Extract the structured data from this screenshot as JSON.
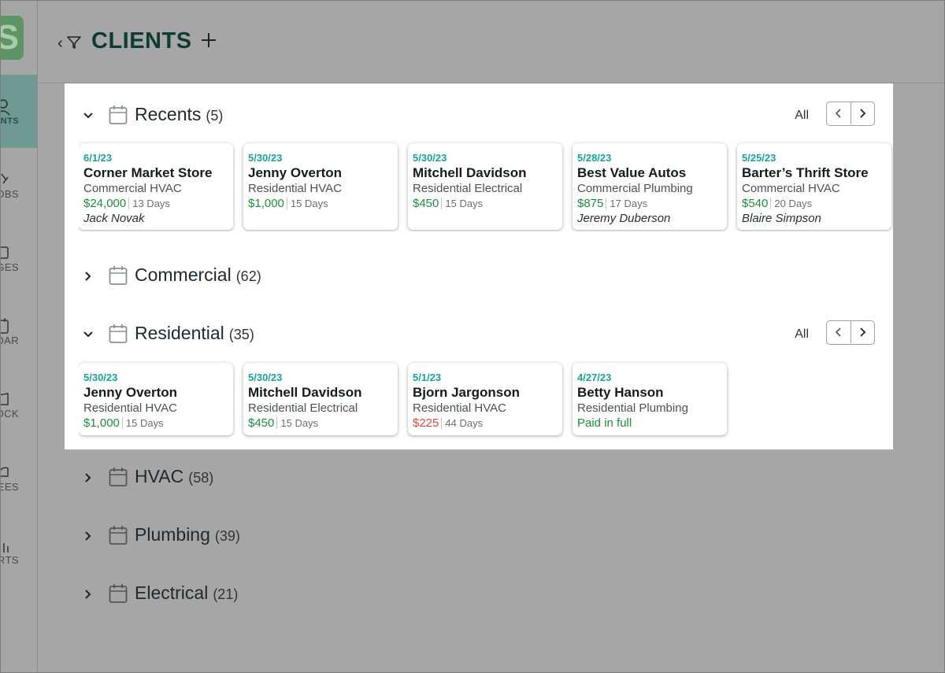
{
  "app": {
    "logo_letter": "S",
    "title": "CLIENTS"
  },
  "sidebar": {
    "items": [
      {
        "label": "CLIENTS",
        "icon": "person-icon",
        "active": true
      },
      {
        "label": "JOBS",
        "icon": "wrench-icon",
        "active": false
      },
      {
        "label": "MESSAGES",
        "icon": "message-icon",
        "active": false
      },
      {
        "label": "CALENDAR",
        "icon": "calendar-icon",
        "active": false
      },
      {
        "label": "STOCK",
        "icon": "stock-icon",
        "active": false
      },
      {
        "label": "EMPLOYEES",
        "icon": "hardhat-icon",
        "active": false
      },
      {
        "label": "REPORTS",
        "icon": "bar-chart-icon",
        "active": false
      }
    ]
  },
  "groups": {
    "recents": {
      "title": "Recents",
      "count": "(5)",
      "all_label": "All",
      "expanded": true,
      "cards": [
        {
          "date": "6/1/23",
          "name": "Corner Market Store",
          "type": "Commercial HVAC",
          "amount": "$24,000",
          "days": "13 Days",
          "contact": "Jack Novak"
        },
        {
          "date": "5/30/23",
          "name": "Jenny Overton",
          "type": "Residential HVAC",
          "amount": "$1,000",
          "days": "15 Days",
          "contact": ""
        },
        {
          "date": "5/30/23",
          "name": "Mitchell Davidson",
          "type": "Residential Electrical",
          "amount": "$450",
          "days": "15 Days",
          "contact": ""
        },
        {
          "date": "5/28/23",
          "name": "Best Value Autos",
          "type": "Commercial Plumbing",
          "amount": "$875",
          "days": "17 Days",
          "contact": "Jeremy Duberson"
        },
        {
          "date": "5/25/23",
          "name": "Barter’s Thrift Store",
          "type": "Commercial HVAC",
          "amount": "$540",
          "days": "20 Days",
          "contact": "Blaire Simpson"
        }
      ]
    },
    "commercial": {
      "title": "Commercial",
      "count": "(62)",
      "expanded": false
    },
    "residential": {
      "title": "Residential",
      "count": "(35)",
      "all_label": "All",
      "expanded": true,
      "cards": [
        {
          "date": "5/30/23",
          "name": "Jenny Overton",
          "type": "Residential HVAC",
          "amount": "$1,000",
          "days": "15 Days"
        },
        {
          "date": "5/30/23",
          "name": "Mitchell Davidson",
          "type": "Residential Electrical",
          "amount": "$450",
          "days": "15 Days"
        },
        {
          "date": "5/1/23",
          "name": "Bjorn Jargonson",
          "type": "Residential HVAC",
          "amount": "$225",
          "days": "44 Days",
          "overdue": true
        },
        {
          "date": "4/27/23",
          "name": "Betty Hanson",
          "type": "Residential Plumbing",
          "paid": "Paid in full"
        }
      ]
    },
    "hvac": {
      "title": "HVAC",
      "count": "(58)",
      "expanded": false
    },
    "plumbing": {
      "title": "Plumbing",
      "count": "(39)",
      "expanded": false
    },
    "electrical": {
      "title": "Electrical",
      "count": "(21)",
      "expanded": false
    }
  },
  "colors": {
    "accent": "#1aa39a",
    "title": "#0f3b36",
    "money": "#1e8f3c",
    "overdue": "#e0473f",
    "overlay": "#a6a6a6"
  }
}
